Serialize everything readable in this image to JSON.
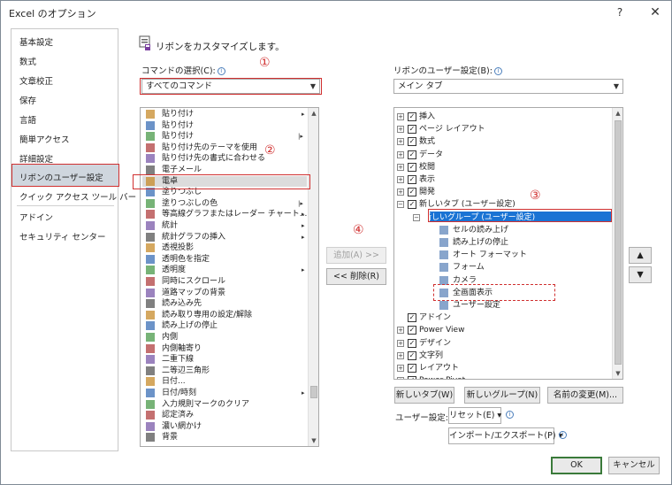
{
  "window": {
    "title": "Excel のオプション",
    "help_label": "?",
    "close_label": "✕"
  },
  "nav": {
    "items": [
      "基本設定",
      "数式",
      "文章校正",
      "保存",
      "言語",
      "簡単アクセス",
      "詳細設定",
      "リボンのユーザー設定",
      "クイック アクセス ツール バー",
      "アドイン",
      "セキュリティ センター"
    ],
    "selected": "リボンのユーザー設定"
  },
  "header": {
    "text": "リボンをカスタマイズします。"
  },
  "left": {
    "label": "コマンドの選択(C):",
    "combo_value": "すべてのコマンド",
    "items": [
      {
        "label": "貼り付け",
        "sub": "▸"
      },
      {
        "label": "貼り付け",
        "sub": ""
      },
      {
        "label": "貼り付け",
        "sub": "|▸"
      },
      {
        "label": "貼り付け先のテーマを使用",
        "sub": ""
      },
      {
        "label": "貼り付け先の書式に合わせる",
        "sub": ""
      },
      {
        "label": "電子メール",
        "sub": ""
      },
      {
        "label": "電卓",
        "sub": ""
      },
      {
        "label": "塗りつぶし",
        "sub": ""
      },
      {
        "label": "塗りつぶしの色",
        "sub": "|▸"
      },
      {
        "label": "等高線グラフまたはレーダー チャート...",
        "sub": "▸"
      },
      {
        "label": "統計",
        "sub": "▸"
      },
      {
        "label": "統計グラフの挿入",
        "sub": "▸"
      },
      {
        "label": "透視投影",
        "sub": ""
      },
      {
        "label": "透明色を指定",
        "sub": ""
      },
      {
        "label": "透明度",
        "sub": "▸"
      },
      {
        "label": "同時にスクロール",
        "sub": ""
      },
      {
        "label": "道路マップの背景",
        "sub": ""
      },
      {
        "label": "読み込み先",
        "sub": ""
      },
      {
        "label": "読み取り専用の設定/解除",
        "sub": ""
      },
      {
        "label": "読み上げの停止",
        "sub": ""
      },
      {
        "label": "内側",
        "sub": ""
      },
      {
        "label": "内側軸寄り",
        "sub": ""
      },
      {
        "label": "二重下線",
        "sub": ""
      },
      {
        "label": "二等辺三角形",
        "sub": ""
      },
      {
        "label": "日付...",
        "sub": ""
      },
      {
        "label": "日付/時刻",
        "sub": "▸"
      },
      {
        "label": "入力規則マークのクリア",
        "sub": ""
      },
      {
        "label": "認定済み",
        "sub": ""
      },
      {
        "label": "濃い網かけ",
        "sub": ""
      },
      {
        "label": "背景",
        "sub": ""
      }
    ]
  },
  "middle": {
    "add_label": "追加(A) >>",
    "remove_label": "<< 削除(R)"
  },
  "right": {
    "label": "リボンのユーザー設定(B):",
    "combo_value": "メイン タブ",
    "tree": [
      {
        "level": 0,
        "exp": "⊞",
        "chk": true,
        "label": "挿入"
      },
      {
        "level": 0,
        "exp": "⊞",
        "chk": true,
        "label": "ページ レイアウト"
      },
      {
        "level": 0,
        "exp": "⊞",
        "chk": true,
        "label": "数式"
      },
      {
        "level": 0,
        "exp": "⊞",
        "chk": true,
        "label": "データ"
      },
      {
        "level": 0,
        "exp": "⊞",
        "chk": true,
        "label": "校閲"
      },
      {
        "level": 0,
        "exp": "⊞",
        "chk": true,
        "label": "表示"
      },
      {
        "level": 0,
        "exp": "⊞",
        "chk": true,
        "label": "開発"
      },
      {
        "level": 0,
        "exp": "⊟",
        "chk": true,
        "label": "新しいタブ (ユーザー設定)"
      },
      {
        "level": 1,
        "exp": "⊟",
        "chk": null,
        "label": "新しいグループ (ユーザー設定)"
      },
      {
        "level": 2,
        "exp": "",
        "chk": null,
        "label": "セルの読み上げ"
      },
      {
        "level": 2,
        "exp": "",
        "chk": null,
        "label": "読み上げの停止"
      },
      {
        "level": 2,
        "exp": "",
        "chk": null,
        "label": "オート フォーマット"
      },
      {
        "level": 2,
        "exp": "",
        "chk": null,
        "label": "フォーム"
      },
      {
        "level": 2,
        "exp": "",
        "chk": null,
        "label": "カメラ"
      },
      {
        "level": 2,
        "exp": "",
        "chk": null,
        "label": "全画面表示"
      },
      {
        "level": 2,
        "exp": "",
        "chk": null,
        "label": "ユーザー設定"
      },
      {
        "level": 0,
        "exp": "",
        "chk": true,
        "label": "アドイン"
      },
      {
        "level": 0,
        "exp": "⊞",
        "chk": true,
        "label": "Power View"
      },
      {
        "level": 0,
        "exp": "⊞",
        "chk": true,
        "label": "デザイン"
      },
      {
        "level": 0,
        "exp": "⊞",
        "chk": true,
        "label": "文字列"
      },
      {
        "level": 0,
        "exp": "⊞",
        "chk": true,
        "label": "レイアウト"
      },
      {
        "level": 0,
        "exp": "⊞",
        "chk": true,
        "label": "Power Pivot"
      }
    ],
    "new_tab_label": "新しいタブ(W)",
    "new_group_label": "新しいグループ(N)",
    "rename_label": "名前の変更(M)...",
    "user_setting_label": "ユーザー設定:",
    "reset_label": "リセット(E) ▾",
    "import_label": "インポート/エクスポート(P) ▾",
    "up_label": "▲",
    "down_label": "▼"
  },
  "annotations": [
    "①",
    "②",
    "③",
    "④"
  ],
  "footer": {
    "ok_label": "OK",
    "cancel_label": "キャンセル"
  }
}
